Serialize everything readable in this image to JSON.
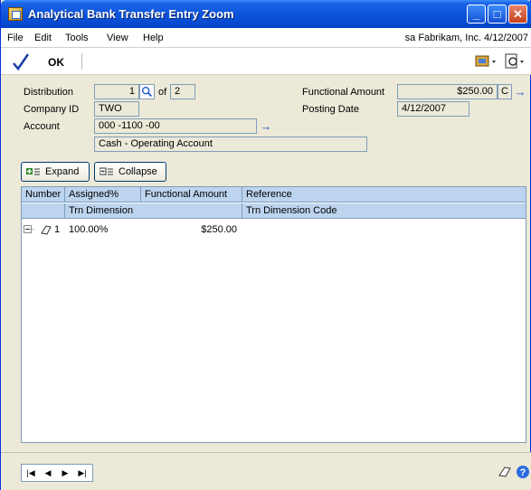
{
  "window": {
    "title": "Analytical Bank Transfer Entry Zoom"
  },
  "menu": {
    "items": [
      "File",
      "Edit",
      "Tools",
      "View",
      "Help"
    ],
    "user_info": "sa  Fabrikam, Inc.  4/12/2007"
  },
  "toolbar": {
    "ok_label": "OK"
  },
  "form": {
    "distribution_label": "Distribution",
    "distribution_value": "1",
    "of_label": "of",
    "distribution_total": "2",
    "company_id_label": "Company ID",
    "company_id_value": "TWO",
    "account_label": "Account",
    "account_value": "000 -1100 -00",
    "account_description": "Cash - Operating Account",
    "functional_amount_label": "Functional Amount",
    "functional_amount_value": "$250.00",
    "currency_code": "C",
    "posting_date_label": "Posting Date",
    "posting_date_value": "4/12/2007"
  },
  "buttons": {
    "expand": "Expand",
    "collapse": "Collapse"
  },
  "grid": {
    "header_row1": [
      "Number",
      "Assigned%",
      "Functional Amount",
      "Reference"
    ],
    "header_row2": [
      "Trn Dimension",
      "Trn Dimension Code"
    ],
    "rows": [
      {
        "number": "1",
        "assigned": "100.00%",
        "amount": "$250.00"
      }
    ]
  }
}
